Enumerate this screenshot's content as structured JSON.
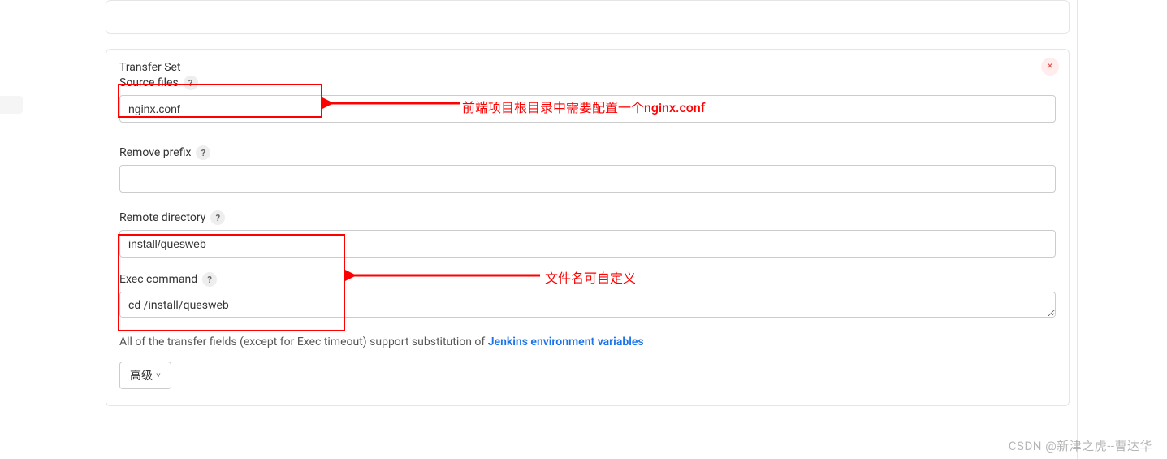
{
  "transferSet": {
    "title": "Transfer Set",
    "sourceFiles": {
      "label": "Source files",
      "value": "nginx.conf"
    },
    "removePrefix": {
      "label": "Remove prefix",
      "value": ""
    },
    "remoteDirectory": {
      "label": "Remote directory",
      "value": "install/quesweb"
    },
    "execCommand": {
      "label": "Exec command",
      "value": "cd /install/quesweb"
    },
    "noteText": "All of the transfer fields (except for Exec timeout) support substitution of ",
    "noteLink": "Jenkins environment variables",
    "advancedButton": "高级"
  },
  "annotations": {
    "a1": "前端项目根目录中需要配置一个nginx.conf",
    "a2": "文件名可自定义"
  },
  "watermark": "CSDN @新津之虎--曹达华",
  "icons": {
    "close": "×",
    "help": "?",
    "chevron": "˅"
  }
}
